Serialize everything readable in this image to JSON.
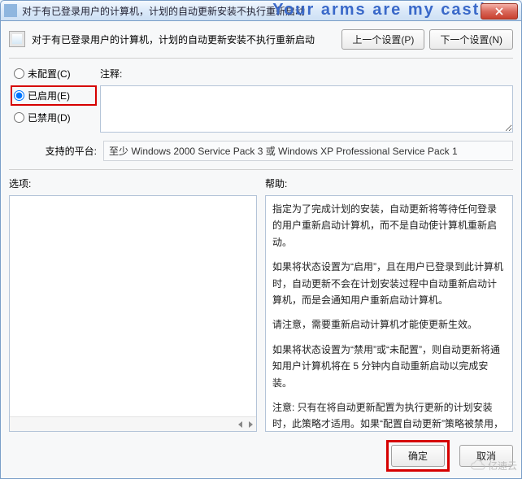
{
  "titlebar": {
    "title": "对于有已登录用户的计算机，计划的自动更新安装不执行重新启动",
    "watermark": "Your arms are my castle"
  },
  "header": {
    "policy_title": "对于有已登录用户的计算机，计划的自动更新安装不执行重新启动",
    "prev_btn": "上一个设置(P)",
    "next_btn": "下一个设置(N)"
  },
  "radios": {
    "not_configured": "未配置(C)",
    "enabled": "已启用(E)",
    "disabled": "已禁用(D)",
    "selected": "enabled"
  },
  "comment": {
    "label": "注释:",
    "value": ""
  },
  "platform": {
    "label": "支持的平台:",
    "value": "至少 Windows 2000 Service Pack 3 或 Windows XP Professional Service Pack 1"
  },
  "options": {
    "label": "选项:"
  },
  "help": {
    "label": "帮助:",
    "paras": [
      "指定为了完成计划的安装，自动更新将等待任何登录的用户重新启动计算机，而不是自动使计算机重新启动。",
      "如果将状态设置为“启用”，且在用户已登录到此计算机时，自动更新不会在计划安装过程中自动重新启动计算机，而是会通知用户重新启动计算机。",
      "请注意，需要重新启动计算机才能使更新生效。",
      "如果将状态设置为“禁用”或“未配置”，则自动更新将通知用户计算机将在 5 分钟内自动重新启动以完成安装。",
      "注意: 只有在将自动更新配置为执行更新的计划安装时，此策略才适用。如果“配置自动更新”策略被禁用，则此策略不起作用。"
    ]
  },
  "footer": {
    "ok": "确定",
    "cancel": "取消"
  },
  "brand": "亿速云"
}
